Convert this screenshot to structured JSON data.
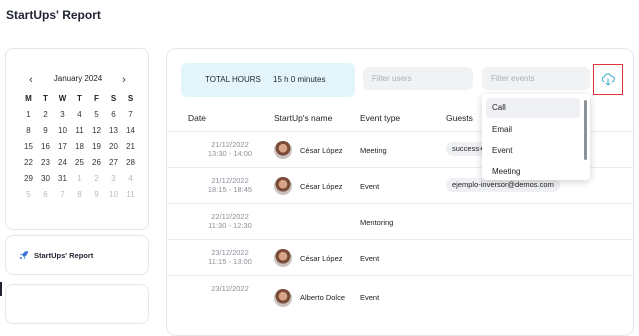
{
  "page": {
    "title": "StartUps' Report"
  },
  "calendar": {
    "prev_label": "‹",
    "next_label": "›",
    "month_label": "January 2024",
    "weekdays": [
      "M",
      "T",
      "W",
      "T",
      "F",
      "S",
      "S"
    ],
    "weeks": [
      [
        "1",
        "2",
        "3",
        "4",
        "5",
        "6",
        "7"
      ],
      [
        "8",
        "9",
        "10",
        "11",
        "12",
        "13",
        "14"
      ],
      [
        "15",
        "16",
        "17",
        "18",
        "19",
        "20",
        "21"
      ],
      [
        "22",
        "23",
        "24",
        "25",
        "26",
        "27",
        "28"
      ],
      [
        "29",
        "30",
        "31",
        "1",
        "2",
        "3",
        "4"
      ],
      [
        "5",
        "6",
        "7",
        "8",
        "9",
        "10",
        "11"
      ]
    ]
  },
  "nav": {
    "report_label": "StartUps' Report",
    "icon": "rocket-icon"
  },
  "summary": {
    "total_label": "TOTAL HOURS",
    "total_value": "15 h 0 minutes"
  },
  "filters": {
    "users_placeholder": "Filter users",
    "events_placeholder": "Filter events",
    "events_options": [
      "Call",
      "Email",
      "Event",
      "Meeting"
    ]
  },
  "download": {
    "icon": "cloud-download-icon",
    "highlight_color": "#e0323a"
  },
  "table": {
    "headers": {
      "date": "Date",
      "startup": "StartUp's name",
      "event": "Event type",
      "guests": "Guests"
    },
    "rows": [
      {
        "date": "21/12/2022",
        "time": "13:30 - 14:00",
        "name": "César López",
        "event": "Meeting",
        "guests": "success+"
      },
      {
        "date": "21/12/2022",
        "time": "18:15 - 18:45",
        "name": "César López",
        "event": "Event",
        "guests": "ejemplo-inversor@demos.com"
      },
      {
        "date": "22/12/2022",
        "time": "11:30 - 12:30",
        "name": "",
        "event": "Mentoring",
        "guests": ""
      },
      {
        "date": "23/12/2022",
        "time": "11:15 - 13:00",
        "name": "César López",
        "event": "Event",
        "guests": ""
      },
      {
        "date": "23/12/2022",
        "time": "",
        "name": "Alberto Dolce",
        "event": "Event",
        "guests": ""
      }
    ]
  },
  "colors": {
    "total_bg": "#e3f5f9",
    "accent": "#3a6fd8"
  }
}
